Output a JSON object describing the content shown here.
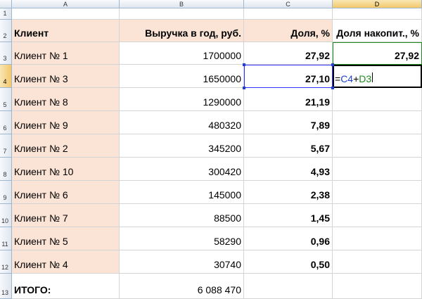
{
  "columns": [
    "A",
    "B",
    "C",
    "D"
  ],
  "rows": [
    {
      "num": "1",
      "cells": [
        "",
        "",
        "",
        ""
      ]
    },
    {
      "num": "2",
      "cells": [
        "Клиент",
        "Выручка в год, руб.",
        "Доля, %",
        "Доля накопит., %"
      ]
    },
    {
      "num": "3",
      "cells": [
        "Клиент № 1",
        "1700000",
        "27,92",
        "27,92"
      ]
    },
    {
      "num": "4",
      "cells": [
        "Клиент № 3",
        "1650000",
        "27,10",
        ""
      ]
    },
    {
      "num": "5",
      "cells": [
        "Клиент № 8",
        "1290000",
        "21,19",
        ""
      ]
    },
    {
      "num": "6",
      "cells": [
        "Клиент № 9",
        "480320",
        "7,89",
        ""
      ]
    },
    {
      "num": "7",
      "cells": [
        "Клиент № 2",
        "345200",
        "5,67",
        ""
      ]
    },
    {
      "num": "8",
      "cells": [
        "Клиент № 10",
        "300420",
        "4,93",
        ""
      ]
    },
    {
      "num": "9",
      "cells": [
        "Клиент № 6",
        "145000",
        "2,38",
        ""
      ]
    },
    {
      "num": "10",
      "cells": [
        "Клиент № 7",
        "88500",
        "1,45",
        ""
      ]
    },
    {
      "num": "11",
      "cells": [
        "Клиент № 5",
        "58290",
        "0,96",
        ""
      ]
    },
    {
      "num": "12",
      "cells": [
        "Клиент № 4",
        "30740",
        "0,50",
        ""
      ]
    },
    {
      "num": "13",
      "cells": [
        "ИТОГО:",
        "6 088 470",
        "",
        ""
      ]
    }
  ],
  "formula": {
    "prefix": "=",
    "ref1": "C4",
    "op": "+",
    "ref2": "D3"
  },
  "colors": {
    "peach": "#fbe4d5",
    "ref1": "#1f3fd6",
    "ref2": "#1e8a1e"
  }
}
